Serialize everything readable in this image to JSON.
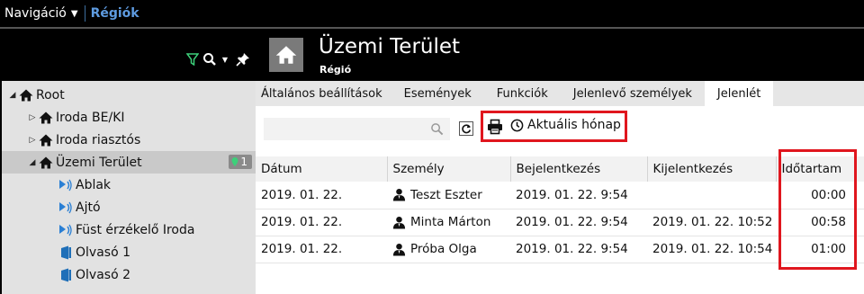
{
  "topbar": {
    "nav_label": "Navigáció",
    "breadcrumb": "Régiók"
  },
  "tools": {
    "filter": "filter-icon",
    "search": "search-icon",
    "pin": "pin-icon"
  },
  "tree": [
    {
      "label": "Root",
      "icon": "house-icon",
      "expand": "expanded"
    },
    {
      "label": "Iroda BE/KI",
      "icon": "house-icon",
      "expand": "collapsed"
    },
    {
      "label": "Iroda riasztós",
      "icon": "house-icon",
      "expand": "collapsed"
    },
    {
      "label": "Üzemi Terület",
      "icon": "house-icon",
      "expand": "expanded",
      "selected": true,
      "badge": "1"
    },
    {
      "label": "Ablak",
      "icon": "sensor-icon"
    },
    {
      "label": "Ajtó",
      "icon": "sensor-icon"
    },
    {
      "label": "Füst érzékelő Iroda",
      "icon": "sensor-icon"
    },
    {
      "label": "Olvasó 1",
      "icon": "reader-icon"
    },
    {
      "label": "Olvasó 2",
      "icon": "reader-icon"
    }
  ],
  "header": {
    "title": "Üzemi Terület",
    "subtitle": "Régió"
  },
  "tabs": [
    {
      "label": "Általános beállítások"
    },
    {
      "label": "Események"
    },
    {
      "label": "Funkciók"
    },
    {
      "label": "Jelenlevő személyek"
    },
    {
      "label": "Jelenlét",
      "active": true
    }
  ],
  "toolbar": {
    "search_placeholder": "",
    "month_label": "Aktuális hónap"
  },
  "table": {
    "columns": [
      "Dátum",
      "Személy",
      "Bejelentkezés",
      "Kijelentkezés",
      "Időtartam"
    ],
    "rows": [
      {
        "date": "2019. 01. 22.",
        "person": "Teszt Eszter",
        "login": "2019. 01. 22. 9:54",
        "logout": "",
        "duration": "00:00"
      },
      {
        "date": "2019. 01. 22.",
        "person": "Minta Márton",
        "login": "2019. 01. 22. 9:54",
        "logout": "2019. 01. 22. 10:52",
        "duration": "00:58"
      },
      {
        "date": "2019. 01. 22.",
        "person": "Próba Olga",
        "login": "2019. 01. 22. 9:54",
        "logout": "2019. 01. 22. 10:54",
        "duration": "01:00"
      }
    ]
  },
  "colors": {
    "accent": "#5e9be0",
    "highlight": "#e0161e",
    "filter": "#3dd07a",
    "sensor": "#2a7fd4",
    "reader": "#1f6fb8"
  }
}
